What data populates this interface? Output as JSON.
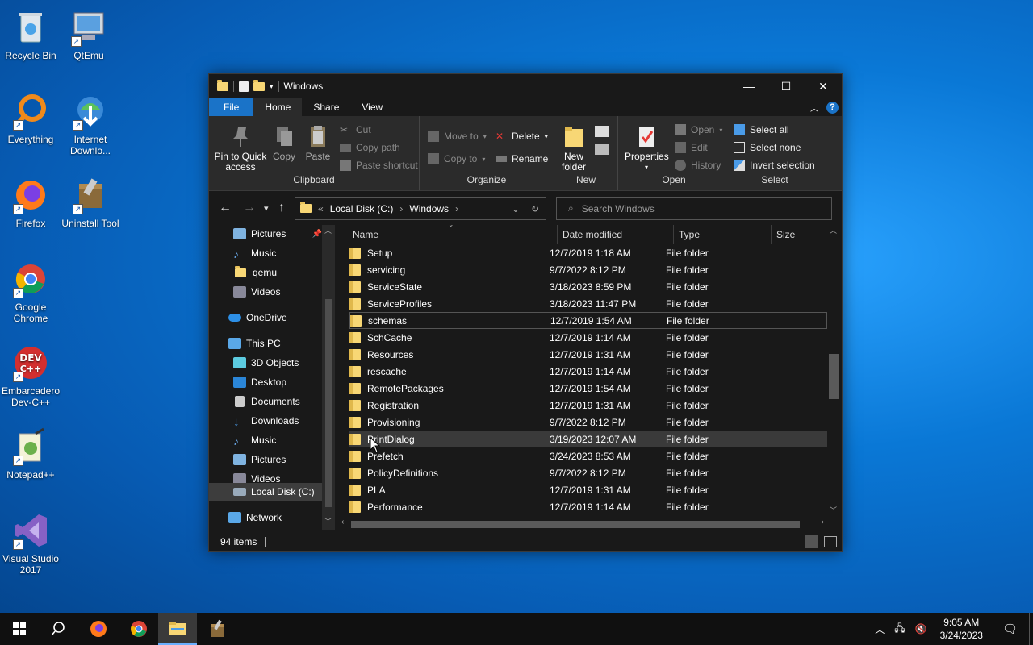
{
  "desktop": {
    "icons": [
      {
        "label": "Recycle Bin"
      },
      {
        "label": "QtEmu"
      },
      {
        "label": "Everything"
      },
      {
        "label": "Internet Downlo..."
      },
      {
        "label": "Firefox"
      },
      {
        "label": "Uninstall Tool"
      },
      {
        "label": "Google Chrome"
      },
      {
        "label": "Embarcadero Dev-C++"
      },
      {
        "label": "Notepad++"
      },
      {
        "label": "Visual Studio 2017"
      }
    ]
  },
  "window": {
    "title": "Windows",
    "tabs": {
      "file": "File",
      "home": "Home",
      "share": "Share",
      "view": "View"
    },
    "ribbon": {
      "clipboard": {
        "label": "Clipboard",
        "pin": "Pin to Quick access",
        "copy": "Copy",
        "paste": "Paste",
        "cut": "Cut",
        "copy_path": "Copy path",
        "paste_shortcut": "Paste shortcut"
      },
      "organize": {
        "label": "Organize",
        "move_to": "Move to",
        "copy_to": "Copy to",
        "delete": "Delete",
        "rename": "Rename"
      },
      "new": {
        "label": "New",
        "new_folder": "New folder"
      },
      "open": {
        "label": "Open",
        "properties": "Properties",
        "open": "Open",
        "edit": "Edit",
        "history": "History"
      },
      "select": {
        "label": "Select",
        "select_all": "Select all",
        "select_none": "Select none",
        "invert": "Invert selection"
      }
    },
    "address": {
      "prefix": "«",
      "crumbs": [
        "Local Disk (C:)",
        "Windows"
      ]
    },
    "search": {
      "placeholder": "Search Windows"
    },
    "nav": {
      "items": [
        {
          "label": "Pictures"
        },
        {
          "label": "Music"
        },
        {
          "label": "qemu"
        },
        {
          "label": "Videos"
        },
        {
          "label": "OneDrive"
        },
        {
          "label": "This PC"
        },
        {
          "label": "3D Objects"
        },
        {
          "label": "Desktop"
        },
        {
          "label": "Documents"
        },
        {
          "label": "Downloads"
        },
        {
          "label": "Music"
        },
        {
          "label": "Pictures"
        },
        {
          "label": "Videos"
        },
        {
          "label": "Local Disk (C:)"
        },
        {
          "label": "Network"
        }
      ]
    },
    "columns": {
      "name": "Name",
      "date": "Date modified",
      "type": "Type",
      "size": "Size"
    },
    "files": [
      {
        "name": "Setup",
        "date": "12/7/2019 1:18 AM",
        "type": "File folder"
      },
      {
        "name": "servicing",
        "date": "9/7/2022 8:12 PM",
        "type": "File folder"
      },
      {
        "name": "ServiceState",
        "date": "3/18/2023 8:59 PM",
        "type": "File folder"
      },
      {
        "name": "ServiceProfiles",
        "date": "3/18/2023 11:47 PM",
        "type": "File folder"
      },
      {
        "name": "schemas",
        "date": "12/7/2019 1:54 AM",
        "type": "File folder"
      },
      {
        "name": "SchCache",
        "date": "12/7/2019 1:14 AM",
        "type": "File folder"
      },
      {
        "name": "Resources",
        "date": "12/7/2019 1:31 AM",
        "type": "File folder"
      },
      {
        "name": "rescache",
        "date": "12/7/2019 1:14 AM",
        "type": "File folder"
      },
      {
        "name": "RemotePackages",
        "date": "12/7/2019 1:54 AM",
        "type": "File folder"
      },
      {
        "name": "Registration",
        "date": "12/7/2019 1:31 AM",
        "type": "File folder"
      },
      {
        "name": "Provisioning",
        "date": "9/7/2022 8:12 PM",
        "type": "File folder"
      },
      {
        "name": "PrintDialog",
        "date": "3/19/2023 12:07 AM",
        "type": "File folder"
      },
      {
        "name": "Prefetch",
        "date": "3/24/2023 8:53 AM",
        "type": "File folder"
      },
      {
        "name": "PolicyDefinitions",
        "date": "9/7/2022 8:12 PM",
        "type": "File folder"
      },
      {
        "name": "PLA",
        "date": "12/7/2019 1:31 AM",
        "type": "File folder"
      },
      {
        "name": "Performance",
        "date": "12/7/2019 1:14 AM",
        "type": "File folder"
      }
    ],
    "status": {
      "count": "94 items"
    }
  },
  "taskbar": {
    "time": "9:05 AM",
    "date": "3/24/2023"
  }
}
